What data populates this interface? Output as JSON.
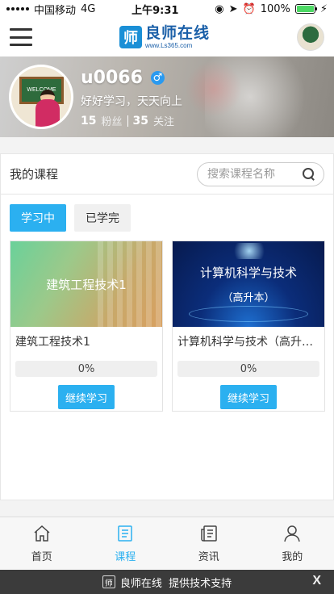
{
  "status_bar": {
    "carrier": "中国移动",
    "network": "4G",
    "time": "上午9:31",
    "battery": "100%"
  },
  "header": {
    "logo_name": "良师在线",
    "logo_url": "www.Ls365.com"
  },
  "profile": {
    "board_text": "WELCOME",
    "username": "u0066",
    "gender_symbol": "♂",
    "motto": "好好学习，天天向上",
    "followers_count": "15",
    "followers_label": "粉丝",
    "following_count": "35",
    "following_label": "关注"
  },
  "courses": {
    "title": "我的课程",
    "search_placeholder": "搜索课程名称",
    "tabs": [
      {
        "label": "学习中",
        "active": true
      },
      {
        "label": "已学完",
        "active": false
      }
    ],
    "items": [
      {
        "thumb_text": "建筑工程技术1",
        "thumb_subtext": "",
        "title": "建筑工程技术1",
        "progress_label": "0%",
        "progress": 0,
        "button": "继续学习"
      },
      {
        "thumb_text": "计算机科学与技术",
        "thumb_subtext": "（高升本）",
        "title": "计算机科学与技术（高升本）",
        "progress_label": "0%",
        "progress": 0,
        "button": "继续学习"
      }
    ]
  },
  "nav": [
    {
      "label": "首页",
      "icon": "home-icon",
      "active": false
    },
    {
      "label": "课程",
      "icon": "course-icon",
      "active": true
    },
    {
      "label": "资讯",
      "icon": "news-icon",
      "active": false
    },
    {
      "label": "我的",
      "icon": "user-icon",
      "active": false
    }
  ],
  "footer": {
    "text": "良师在线  提供技术支持",
    "close": "X"
  },
  "colors": {
    "accent": "#2bb0f0",
    "brand": "#1a5fa8"
  }
}
